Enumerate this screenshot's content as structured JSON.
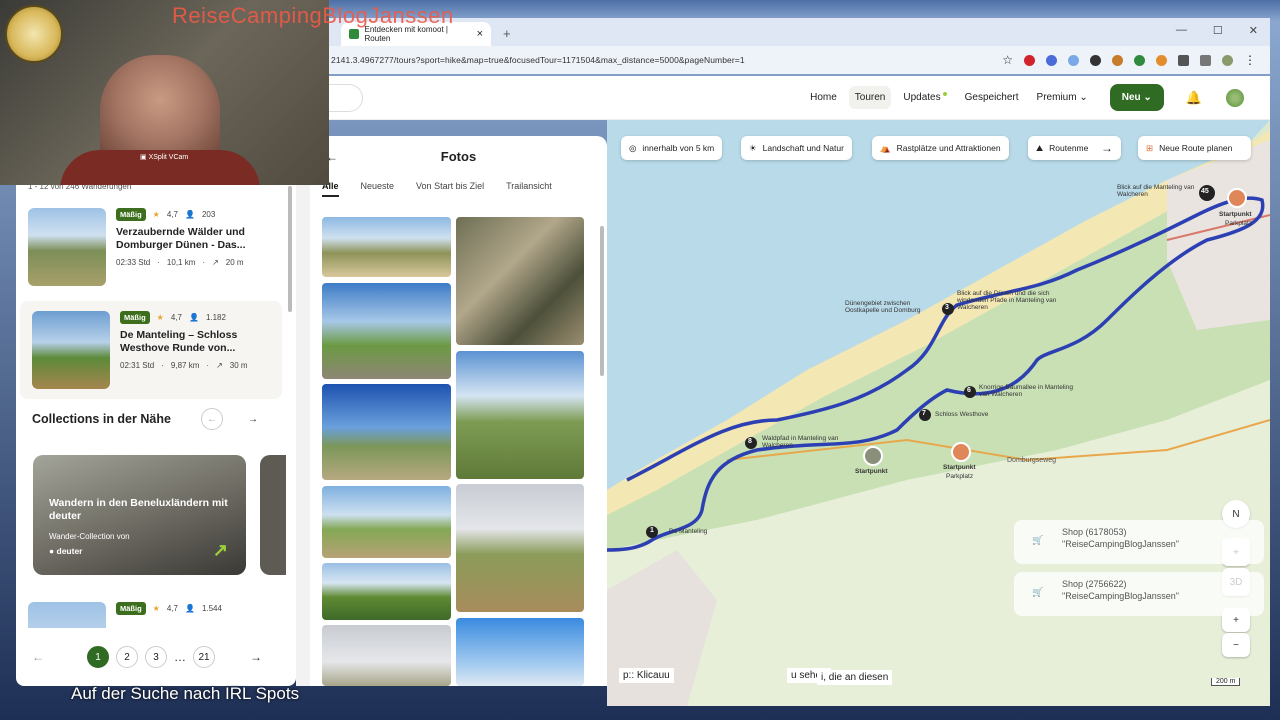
{
  "overlay": {
    "channel_title": "ReiseCampingBlogJanssen",
    "vcam_label": "XSplit VCam",
    "bottom_caption": "Auf der Suche nach IRL Spots"
  },
  "browser": {
    "tab_title": "Entdecken mit komoot | Routen",
    "url": "2141.3.4967277/tours?sport=hike&map=true&focusedTour=1171504&max_distance=5000&pageNumber=1"
  },
  "nav": {
    "links": [
      "Home",
      "Touren",
      "Updates",
      "Gespeichert",
      "Premium"
    ],
    "new_label": "Neu"
  },
  "list": {
    "count_text": "1 - 12 von 246 Wanderungen",
    "tours": [
      {
        "badge": "Mäßig",
        "rating": "4,7",
        "votes": "203",
        "title": "Verzaubernde Wälder und Domburger Dünen - Das...",
        "duration": "02:33 Std",
        "distance": "10,1 km",
        "ascent": "20 m"
      },
      {
        "badge": "Mäßig",
        "rating": "4,7",
        "votes": "1.182",
        "title": "De Manteling – Schloss Westhove Runde von...",
        "duration": "02:31 Std",
        "distance": "9,87 km",
        "ascent": "30 m"
      },
      {
        "badge": "Mäßig",
        "rating": "4,7",
        "votes": "1.544"
      }
    ],
    "collections_heading": "Collections in der Nähe",
    "collection": {
      "title": "Wandern in den Beneluxländern mit deuter",
      "subtitle": "Wander-Collection von",
      "brand": "deuter"
    },
    "pages": [
      "1",
      "2",
      "3",
      "…",
      "21"
    ]
  },
  "fotos": {
    "title": "Fotos",
    "tabs": [
      "Alle",
      "Neueste",
      "Von Start bis Ziel",
      "Trailansicht"
    ]
  },
  "map": {
    "filters": [
      "innerhalb von 5 km",
      "Landschaft und Natur",
      "Rastplätze und Attraktionen",
      "Routenme"
    ],
    "plan_label": "Neue Route planen",
    "labels": {
      "start1": "Startpunkt",
      "start2": "Startpunkt",
      "park": "Parkplatz",
      "road": "Domburgseweg",
      "dunes": "Dünengebiet zwischen Oostkapelle und Domburg",
      "blick": "Blick auf die Dünen und die sich windenden Pfade in Manteling van Walcheren",
      "baum": "Knorrige Baumallee in Manteling van Walcheren",
      "schloss": "Schloss Westhove",
      "wald": "Waldpfad in Manteling van Walcheren",
      "manteling": "De Manteling",
      "blick2": "Blick auf die Manteling van Walcheren",
      "start3": "Startpunkt",
      "park3": "Parkplatz"
    },
    "waypoints": [
      "45",
      "3",
      "6",
      "7",
      "8",
      "1"
    ],
    "compass": "N",
    "three_d": "3D",
    "zoom_in": "+",
    "zoom_out": "−",
    "scale": "200 m",
    "shop1": {
      "line1": "Shop (6178053)",
      "line2": "\"ReiseCampingBlogJanssen\""
    },
    "shop2": {
      "line1": "Shop (2756622)",
      "line2": "\"ReiseCampingBlogJanssen\""
    },
    "chat_fragments": [
      "p:: Klicauu",
      "u sehen",
      "i, die an diesen"
    ]
  }
}
